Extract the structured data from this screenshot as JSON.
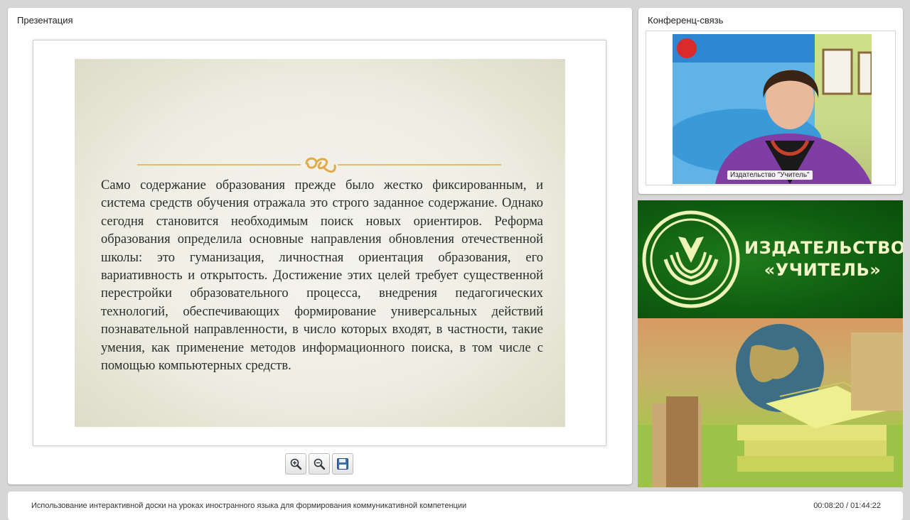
{
  "presentation": {
    "title": "Презентация",
    "slide_text": "Само содержание образования прежде было жестко фиксированным, и система средств обучения отражала это строго заданное содержание. Однако сегодня становится необходимым поиск новых ориентиров. Реформа образования определила основные направления обновления отечественной школы: это гуманизация, личностная ориентация образования, его вариативность и открытость. Достижение этих целей требует существенной перестройки образовательного процесса, внедрения педагогических технологий, обеспечивающих формирование универсальных действий познавательной направленности, в число которых входят, в частности, такие умения, как применение методов информационного поиска, в том числе с помощью компьютерных средств.",
    "toolbar": [
      {
        "name": "zoom-in-button",
        "icon": "zoom-in-icon"
      },
      {
        "name": "zoom-out-button",
        "icon": "zoom-out-icon"
      },
      {
        "name": "save-button",
        "icon": "floppy-disk-icon"
      }
    ]
  },
  "conference": {
    "title": "Конференц-связь",
    "speaker_label": "Издательство \"Учитель\""
  },
  "banner": {
    "publisher_line1": "ИЗДАТЕЛЬСТВО",
    "publisher_line2": "«УЧИТЕЛЬ»"
  },
  "footer": {
    "lecture_title": "Использование интерактивной доски на уроках иностранного языка для формирования коммуникативной компетенции",
    "time": "00:08:20 / 01:44:22"
  },
  "colors": {
    "banner_green": "#0f5e10",
    "banner_text": "#f3f6c8",
    "ornament_gold": "#e0a94a"
  }
}
